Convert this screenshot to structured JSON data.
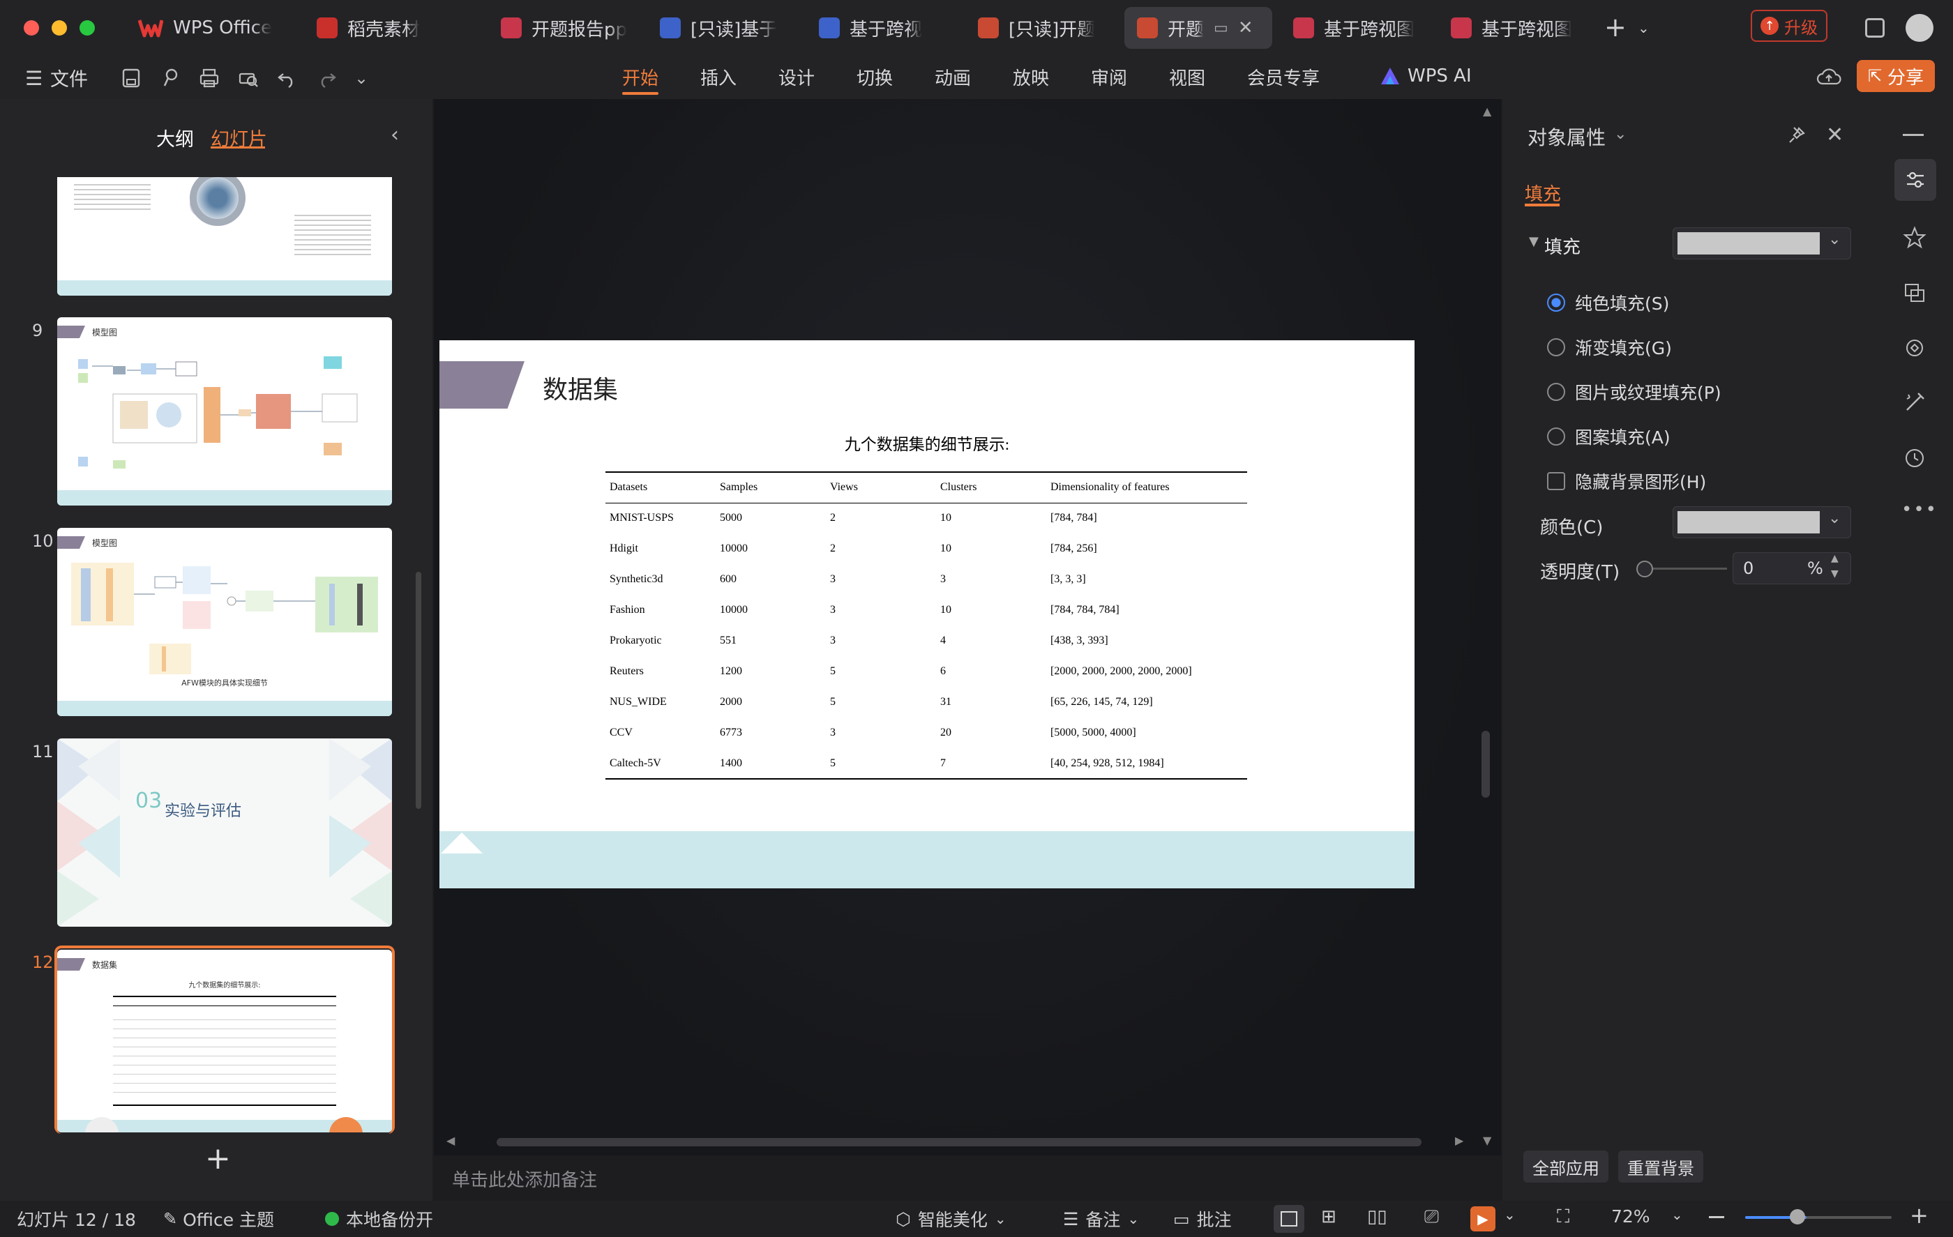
{
  "tabs": [
    {
      "label": "WPS Office"
    },
    {
      "label": "稻壳素材"
    },
    {
      "label": "开题报告pp"
    },
    {
      "label": "[只读]基于"
    },
    {
      "label": "基于跨视"
    },
    {
      "label": "[只读]开题"
    },
    {
      "label": "开题"
    },
    {
      "label": "基于跨视图"
    },
    {
      "label": "基于跨视图"
    }
  ],
  "upgrade_label": "升级",
  "toolbar": {
    "file_label": "文件",
    "menus": [
      "开始",
      "插入",
      "设计",
      "切换",
      "动画",
      "放映",
      "审阅",
      "视图",
      "会员专享"
    ],
    "wps_ai": "WPS AI",
    "share_label": "分享"
  },
  "left_panel": {
    "tab_outline": "大纲",
    "tab_slides": "幻灯片",
    "thumbs": [
      {
        "num": ""
      },
      {
        "num": "9",
        "title": "模型图"
      },
      {
        "num": "10",
        "title": "模型图",
        "caption": "AFW模块的具体实现细节"
      },
      {
        "num": "11",
        "section_no": "03",
        "section_title": "实验与评估"
      },
      {
        "num": "12",
        "title": "数据集",
        "subtitle": "九个数据集的细节展示:"
      }
    ]
  },
  "slide": {
    "title": "数据集",
    "subtitle": "九个数据集的细节展示:",
    "table": {
      "headers": [
        "Datasets",
        "Samples",
        "Views",
        "Clusters",
        "Dimensionality of features"
      ],
      "rows": [
        [
          "MNIST-USPS",
          "5000",
          "2",
          "10",
          "[784, 784]"
        ],
        [
          "Hdigit",
          "10000",
          "2",
          "10",
          "[784, 256]"
        ],
        [
          "Synthetic3d",
          "600",
          "3",
          "3",
          "[3, 3, 3]"
        ],
        [
          "Fashion",
          "10000",
          "3",
          "10",
          "[784, 784, 784]"
        ],
        [
          "Prokaryotic",
          "551",
          "3",
          "4",
          "[438, 3, 393]"
        ],
        [
          "Reuters",
          "1200",
          "5",
          "6",
          "[2000, 2000, 2000, 2000, 2000]"
        ],
        [
          "NUS_WIDE",
          "2000",
          "5",
          "31",
          "[65, 226, 145, 74, 129]"
        ],
        [
          "CCV",
          "6773",
          "3",
          "20",
          "[5000, 5000, 4000]"
        ],
        [
          "Caltech-5V",
          "1400",
          "5",
          "7",
          "[40, 254, 928, 512, 1984]"
        ]
      ]
    }
  },
  "notes_placeholder": "单击此处添加备注",
  "properties": {
    "title": "对象属性",
    "tab": "填充",
    "section": "填充",
    "options": [
      "纯色填充(S)",
      "渐变填充(G)",
      "图片或纹理填充(P)",
      "图案填充(A)"
    ],
    "selected_option": 0,
    "hide_bg": "隐藏背景图形(H)",
    "color_label": "颜色(C)",
    "transparency_label": "透明度(T)",
    "transparency_value": "0",
    "percent": "%",
    "apply_all": "全部应用",
    "reset_bg": "重置背景"
  },
  "status": {
    "slide_counter": "幻灯片 12 / 18",
    "theme": "Office 主题",
    "backup": "本地备份开",
    "beautify": "智能美化",
    "notes": "备注",
    "comments": "批注",
    "zoom": "72%"
  },
  "colors": {
    "accent": "#f07c3a",
    "selected_radio": "#4a8cff",
    "slide_band": "#cde8ec",
    "title_bar": "#8a8198"
  }
}
